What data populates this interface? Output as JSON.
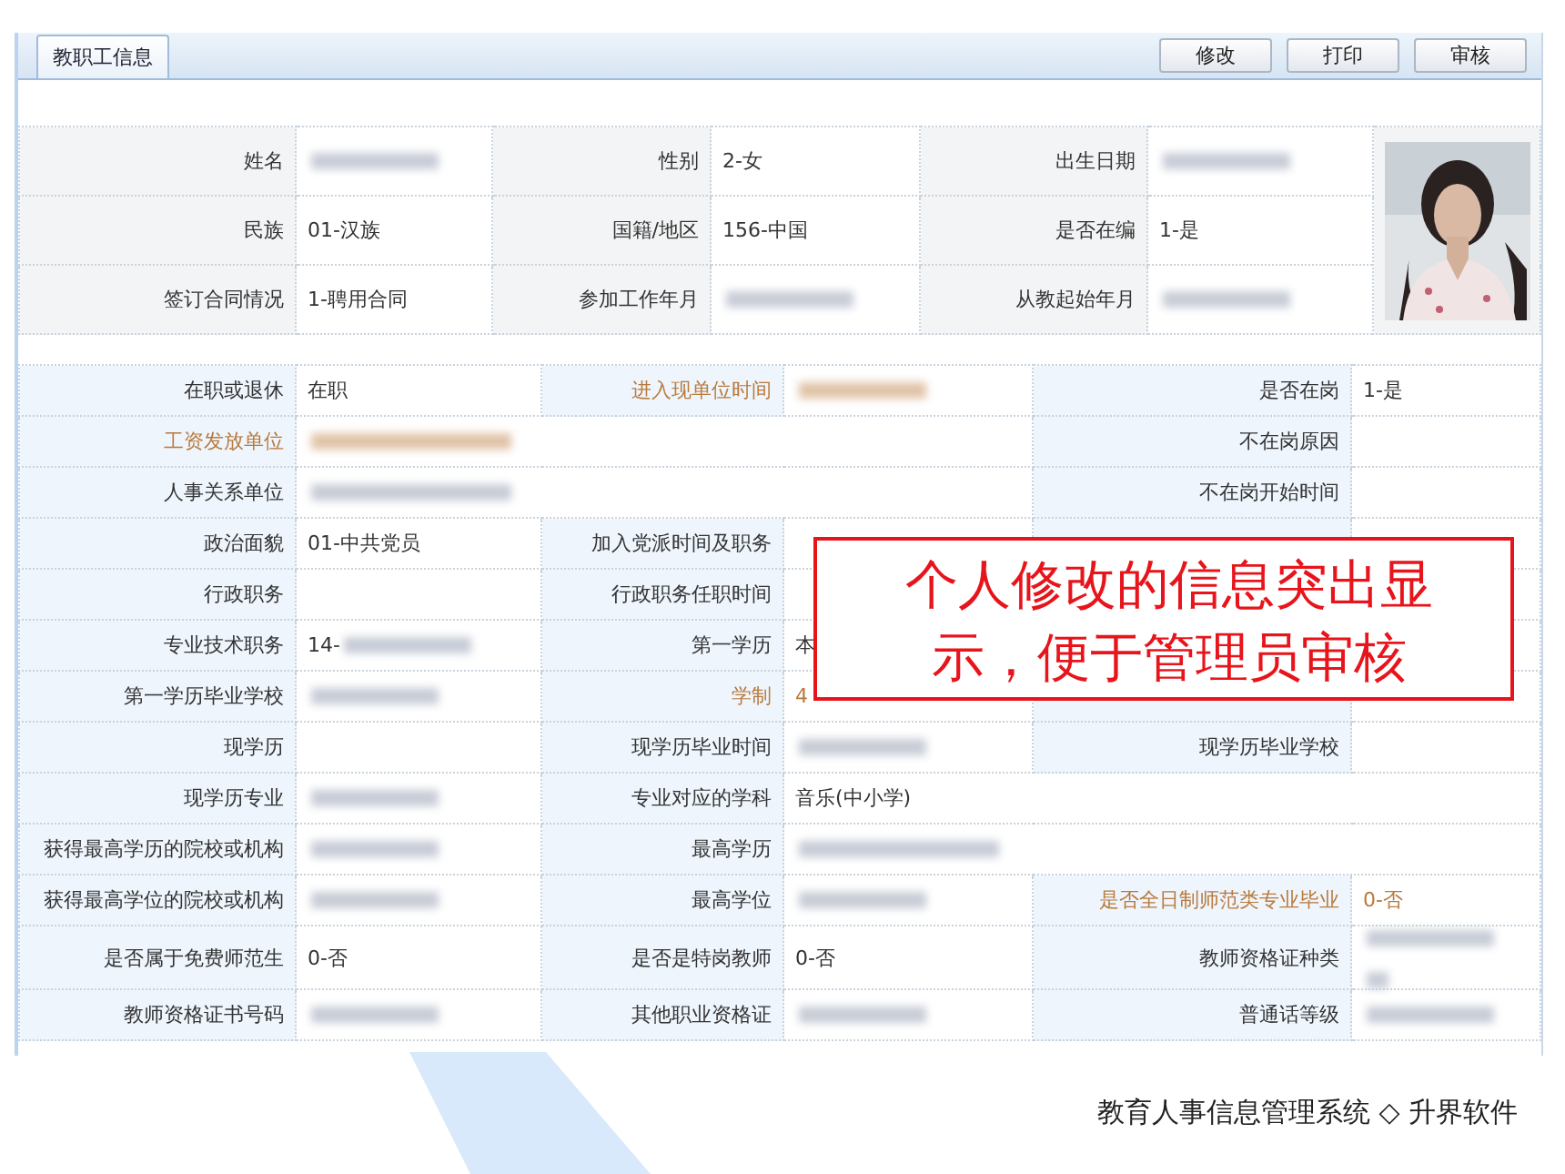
{
  "panel": {
    "tab": {
      "label": "教职工信息",
      "selected": true
    },
    "buttons": [
      "修改",
      "打印",
      "审核"
    ]
  },
  "summary": {
    "rows": [
      [
        {
          "label": "姓名",
          "blurred": true
        },
        {
          "label": "性别",
          "value": "2-女"
        },
        {
          "label": "出生日期",
          "blurred": true
        }
      ],
      [
        {
          "label": "民族",
          "value": "01-汉族"
        },
        {
          "label": "国籍/地区",
          "value": "156-中国"
        },
        {
          "label": "是否在编",
          "value": "1-是"
        }
      ],
      [
        {
          "label": "签订合同情况",
          "value": "1-聘用合同"
        },
        {
          "label": "参加工作年月",
          "blurred": true
        },
        {
          "label": "从教起始年月",
          "blurred": true
        }
      ]
    ]
  },
  "details": {
    "rows": [
      {
        "fields": [
          {
            "label": "在职或退休",
            "value": "在职"
          },
          {
            "label": "进入现单位时间",
            "blurred": true,
            "highlighted": true
          },
          {
            "label": "是否在岗",
            "value": "1-是"
          }
        ]
      },
      {
        "fields": [
          {
            "label": "工资发放单位",
            "blurred": true,
            "highlighted": true,
            "wide": true
          },
          {
            "label": "不在岗原因"
          }
        ]
      },
      {
        "fields": [
          {
            "label": "人事关系单位",
            "blurred": true,
            "wide": true
          },
          {
            "label": "不在岗开始时间"
          }
        ]
      },
      {
        "fields": [
          {
            "label": "政治面貌",
            "value": "01-中共党员"
          },
          {
            "label": "加入党派时间及职务"
          }
        ]
      },
      {
        "fields": [
          {
            "label": "行政职务"
          },
          {
            "label": "行政职务任职时间"
          }
        ]
      },
      {
        "fields": [
          {
            "label": "专业技术职务",
            "value": "14-",
            "blurred": true
          },
          {
            "label": "第一学历",
            "value": "本"
          }
        ]
      },
      {
        "fields": [
          {
            "label": "第一学历毕业学校",
            "blurred": true
          },
          {
            "label": "学制",
            "value": "4",
            "highlighted": true
          }
        ]
      },
      {
        "fields": [
          {
            "label": "现学历"
          },
          {
            "label": "现学历毕业时间",
            "blurred": true
          },
          {
            "label": "现学历毕业学校"
          }
        ]
      },
      {
        "fields": [
          {
            "label": "现学历专业",
            "blurred": true
          },
          {
            "label": "专业对应的学科",
            "value": "音乐(中小学)",
            "wide": true
          }
        ]
      },
      {
        "fields": [
          {
            "label": "获得最高学历的院校或机构",
            "blurred": true
          },
          {
            "label": "最高学历",
            "blurred": true,
            "wide": true
          }
        ]
      },
      {
        "fields": [
          {
            "label": "获得最高学位的院校或机构",
            "blurred": true
          },
          {
            "label": "最高学位",
            "blurred": true
          },
          {
            "label": "是否全日制师范类专业毕业",
            "value": "0-否",
            "highlighted": true
          }
        ]
      },
      {
        "fields": [
          {
            "label": "是否属于免费师范生",
            "value": "0-否"
          },
          {
            "label": "是否是特岗教师",
            "value": "0-否"
          },
          {
            "label": "教师资格证种类",
            "blurred": true,
            "wrapped": true
          }
        ]
      },
      {
        "fields": [
          {
            "label": "教师资格证书号码",
            "blurred": true
          },
          {
            "label": "其他职业资格证",
            "blurred": true
          },
          {
            "label": "普通话等级",
            "blurred": true
          }
        ]
      }
    ]
  },
  "callout": {
    "text": "个人修改的信息突出显示，便于管理员审核"
  },
  "footer": {
    "text": "教育人事信息管理系统 ◇ 升界软件"
  }
}
